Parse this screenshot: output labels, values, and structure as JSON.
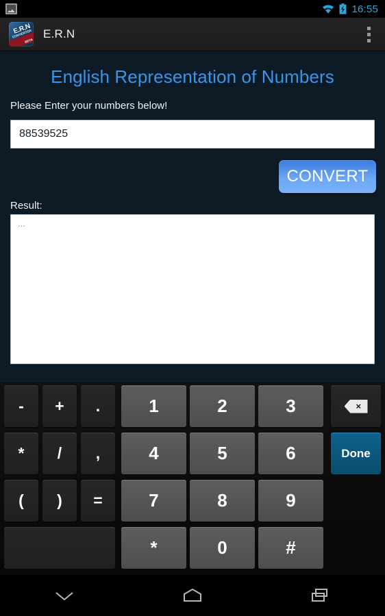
{
  "status_bar": {
    "notification_icon": "screenshot-icon",
    "wifi_icon": "wifi-icon",
    "battery_icon": "battery-charging-icon",
    "time": "16:55",
    "accent_color": "#2aa6d8"
  },
  "action_bar": {
    "app_icon": "ern-app-icon",
    "icon_text": "E.R.N",
    "icon_subtext": "CONVERTER",
    "icon_tag": "BETA",
    "title": "E.R.N",
    "overflow_icon": "overflow-menu-icon"
  },
  "app": {
    "title": "English Representation of Numbers",
    "title_color": "#3a94e8",
    "subtitle": "Please Enter your numbers below!",
    "input": {
      "value": "88539525",
      "placeholder": ""
    },
    "convert_button": {
      "label": "CONVERT",
      "color": "#6ba7f4"
    },
    "result_label": "Result:",
    "result_value": "...",
    "result_color": "#4aa3ea",
    "background_color": "#0d1b26"
  },
  "keyboard": {
    "rows": [
      [
        {
          "label": "-",
          "type": "sym",
          "name": "key-minus"
        },
        {
          "label": "+",
          "type": "sym",
          "name": "key-plus"
        },
        {
          "label": ".",
          "type": "sym",
          "name": "key-period"
        },
        {
          "label": "1",
          "type": "num",
          "name": "key-1"
        },
        {
          "label": "2",
          "type": "num",
          "name": "key-2"
        },
        {
          "label": "3",
          "type": "num",
          "name": "key-3"
        },
        {
          "label": "",
          "type": "fn",
          "name": "key-backspace",
          "icon": "backspace-icon"
        }
      ],
      [
        {
          "label": "*",
          "type": "sym",
          "name": "key-asterisk-left"
        },
        {
          "label": "/",
          "type": "sym",
          "name": "key-slash"
        },
        {
          "label": ",",
          "type": "sym",
          "name": "key-comma"
        },
        {
          "label": "4",
          "type": "num",
          "name": "key-4"
        },
        {
          "label": "5",
          "type": "num",
          "name": "key-5"
        },
        {
          "label": "6",
          "type": "num",
          "name": "key-6"
        },
        {
          "label": "Done",
          "type": "done",
          "name": "key-done"
        }
      ],
      [
        {
          "label": "(",
          "type": "sym",
          "name": "key-paren-open"
        },
        {
          "label": ")",
          "type": "sym",
          "name": "key-paren-close"
        },
        {
          "label": "=",
          "type": "sym",
          "name": "key-equals"
        },
        {
          "label": "7",
          "type": "num",
          "name": "key-7"
        },
        {
          "label": "8",
          "type": "num",
          "name": "key-8"
        },
        {
          "label": "9",
          "type": "num",
          "name": "key-9"
        }
      ],
      [
        {
          "label": "",
          "type": "blank",
          "name": "key-blank-wide"
        },
        {
          "label": "*",
          "type": "num",
          "name": "key-asterisk"
        },
        {
          "label": "0",
          "type": "num",
          "name": "key-0"
        },
        {
          "label": "#",
          "type": "num",
          "name": "key-hash"
        }
      ]
    ]
  },
  "nav_bar": {
    "back_icon": "hide-keyboard-chevron-icon",
    "home_icon": "home-icon",
    "recents_icon": "recent-apps-icon"
  }
}
